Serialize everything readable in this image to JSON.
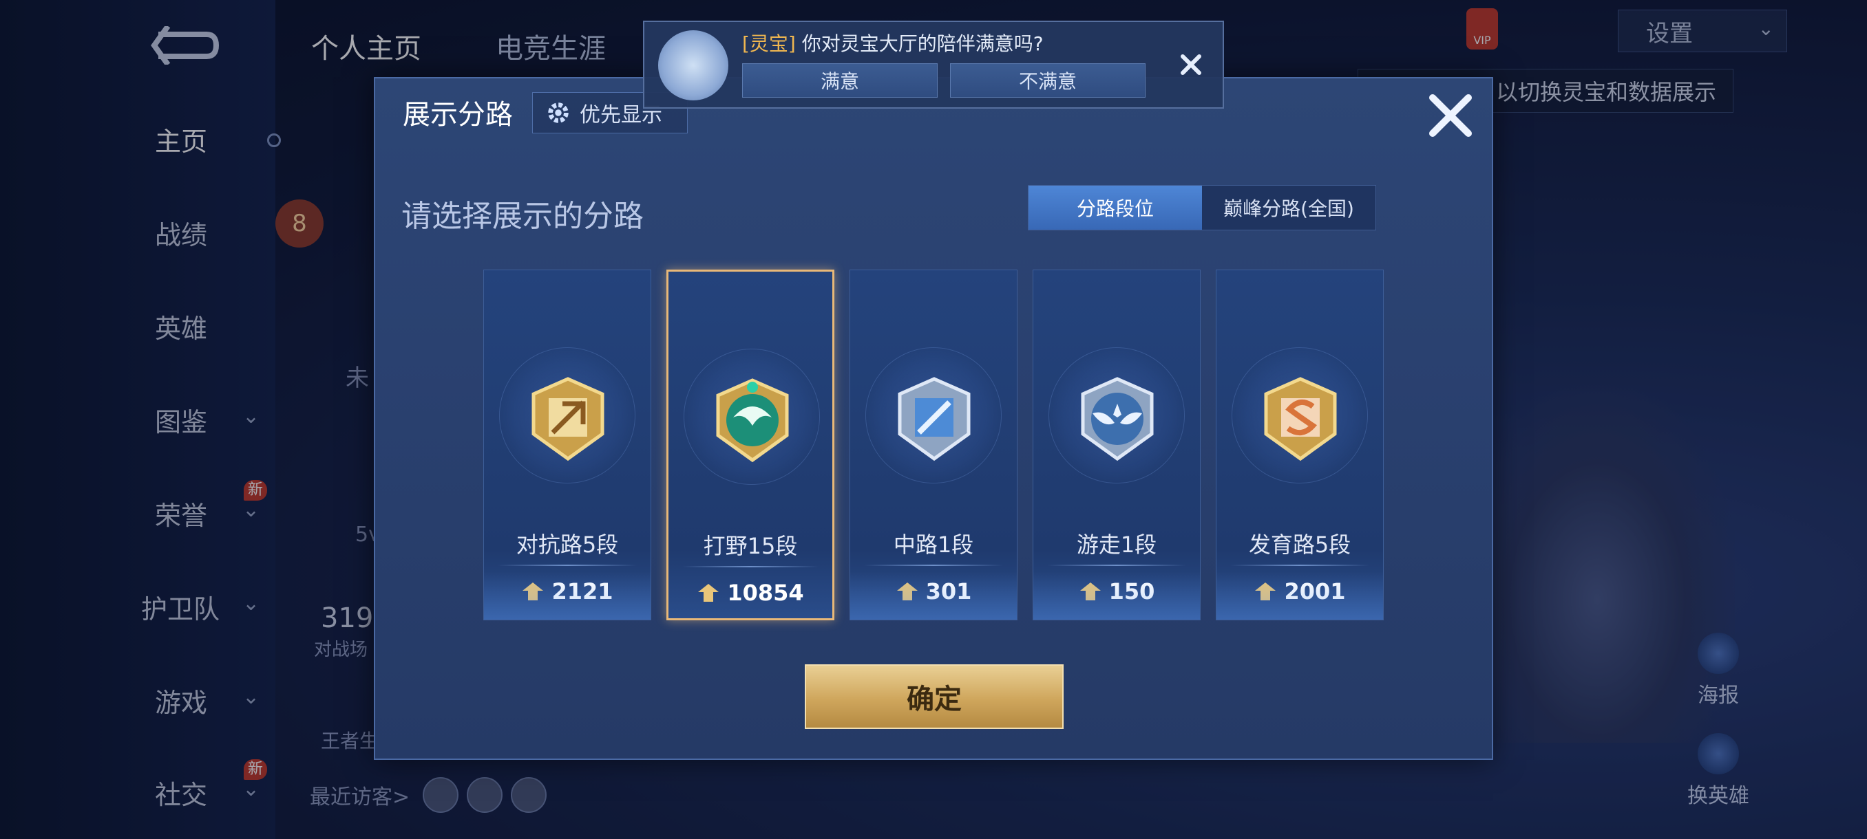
{
  "left_nav": {
    "items": [
      {
        "label": "主页",
        "active": true
      },
      {
        "label": "战绩"
      },
      {
        "label": "英雄"
      },
      {
        "label": "图鉴"
      },
      {
        "label": "荣誉",
        "badge": "新"
      },
      {
        "label": "护卫队"
      },
      {
        "label": "游戏"
      },
      {
        "label": "社交",
        "badge": "新"
      }
    ]
  },
  "top_tabs": [
    "个人主页",
    "电竞生涯"
  ],
  "settings": {
    "label": "设置"
  },
  "vip": {
    "label": "VIP"
  },
  "tip_bar": {
    "text": "以切换灵宝和数据展示"
  },
  "side_actions": [
    "海报",
    "换英雄"
  ],
  "background": {
    "level": "8",
    "partial_texts": [
      "未",
      "5v",
      "319",
      "对战场",
      "王者生"
    ]
  },
  "recent_visitors": {
    "label": "最近访客>"
  },
  "new_badge": "新",
  "survey": {
    "tag": "[灵宝]",
    "question": "你对灵宝大厅的陪伴满意吗?",
    "options": [
      "满意",
      "不满意"
    ]
  },
  "dialog": {
    "title": "展示分路",
    "priority_label": "优先显示",
    "subtitle": "请选择展示的分路",
    "tabs": [
      {
        "label": "分路段位",
        "active": true
      },
      {
        "label": "巅峰分路(全国)",
        "active": false
      }
    ],
    "lanes": [
      {
        "name": "对抗路5段",
        "score": "2121",
        "icon": "clash-lane-emblem-icon",
        "color": "#d7a84a",
        "selected": false
      },
      {
        "name": "打野15段",
        "score": "10854",
        "icon": "jungle-dragon-emblem-icon",
        "color": "#1fa88a",
        "selected": true
      },
      {
        "name": "中路1段",
        "score": "301",
        "icon": "mid-lane-emblem-icon",
        "color": "#6aa2e0",
        "selected": false
      },
      {
        "name": "游走1段",
        "score": "150",
        "icon": "roam-wings-emblem-icon",
        "color": "#8fb0d8",
        "selected": false
      },
      {
        "name": "发育路5段",
        "score": "2001",
        "icon": "farm-lane-emblem-icon",
        "color": "#e0884a",
        "selected": false
      }
    ],
    "confirm_label": "确定"
  }
}
